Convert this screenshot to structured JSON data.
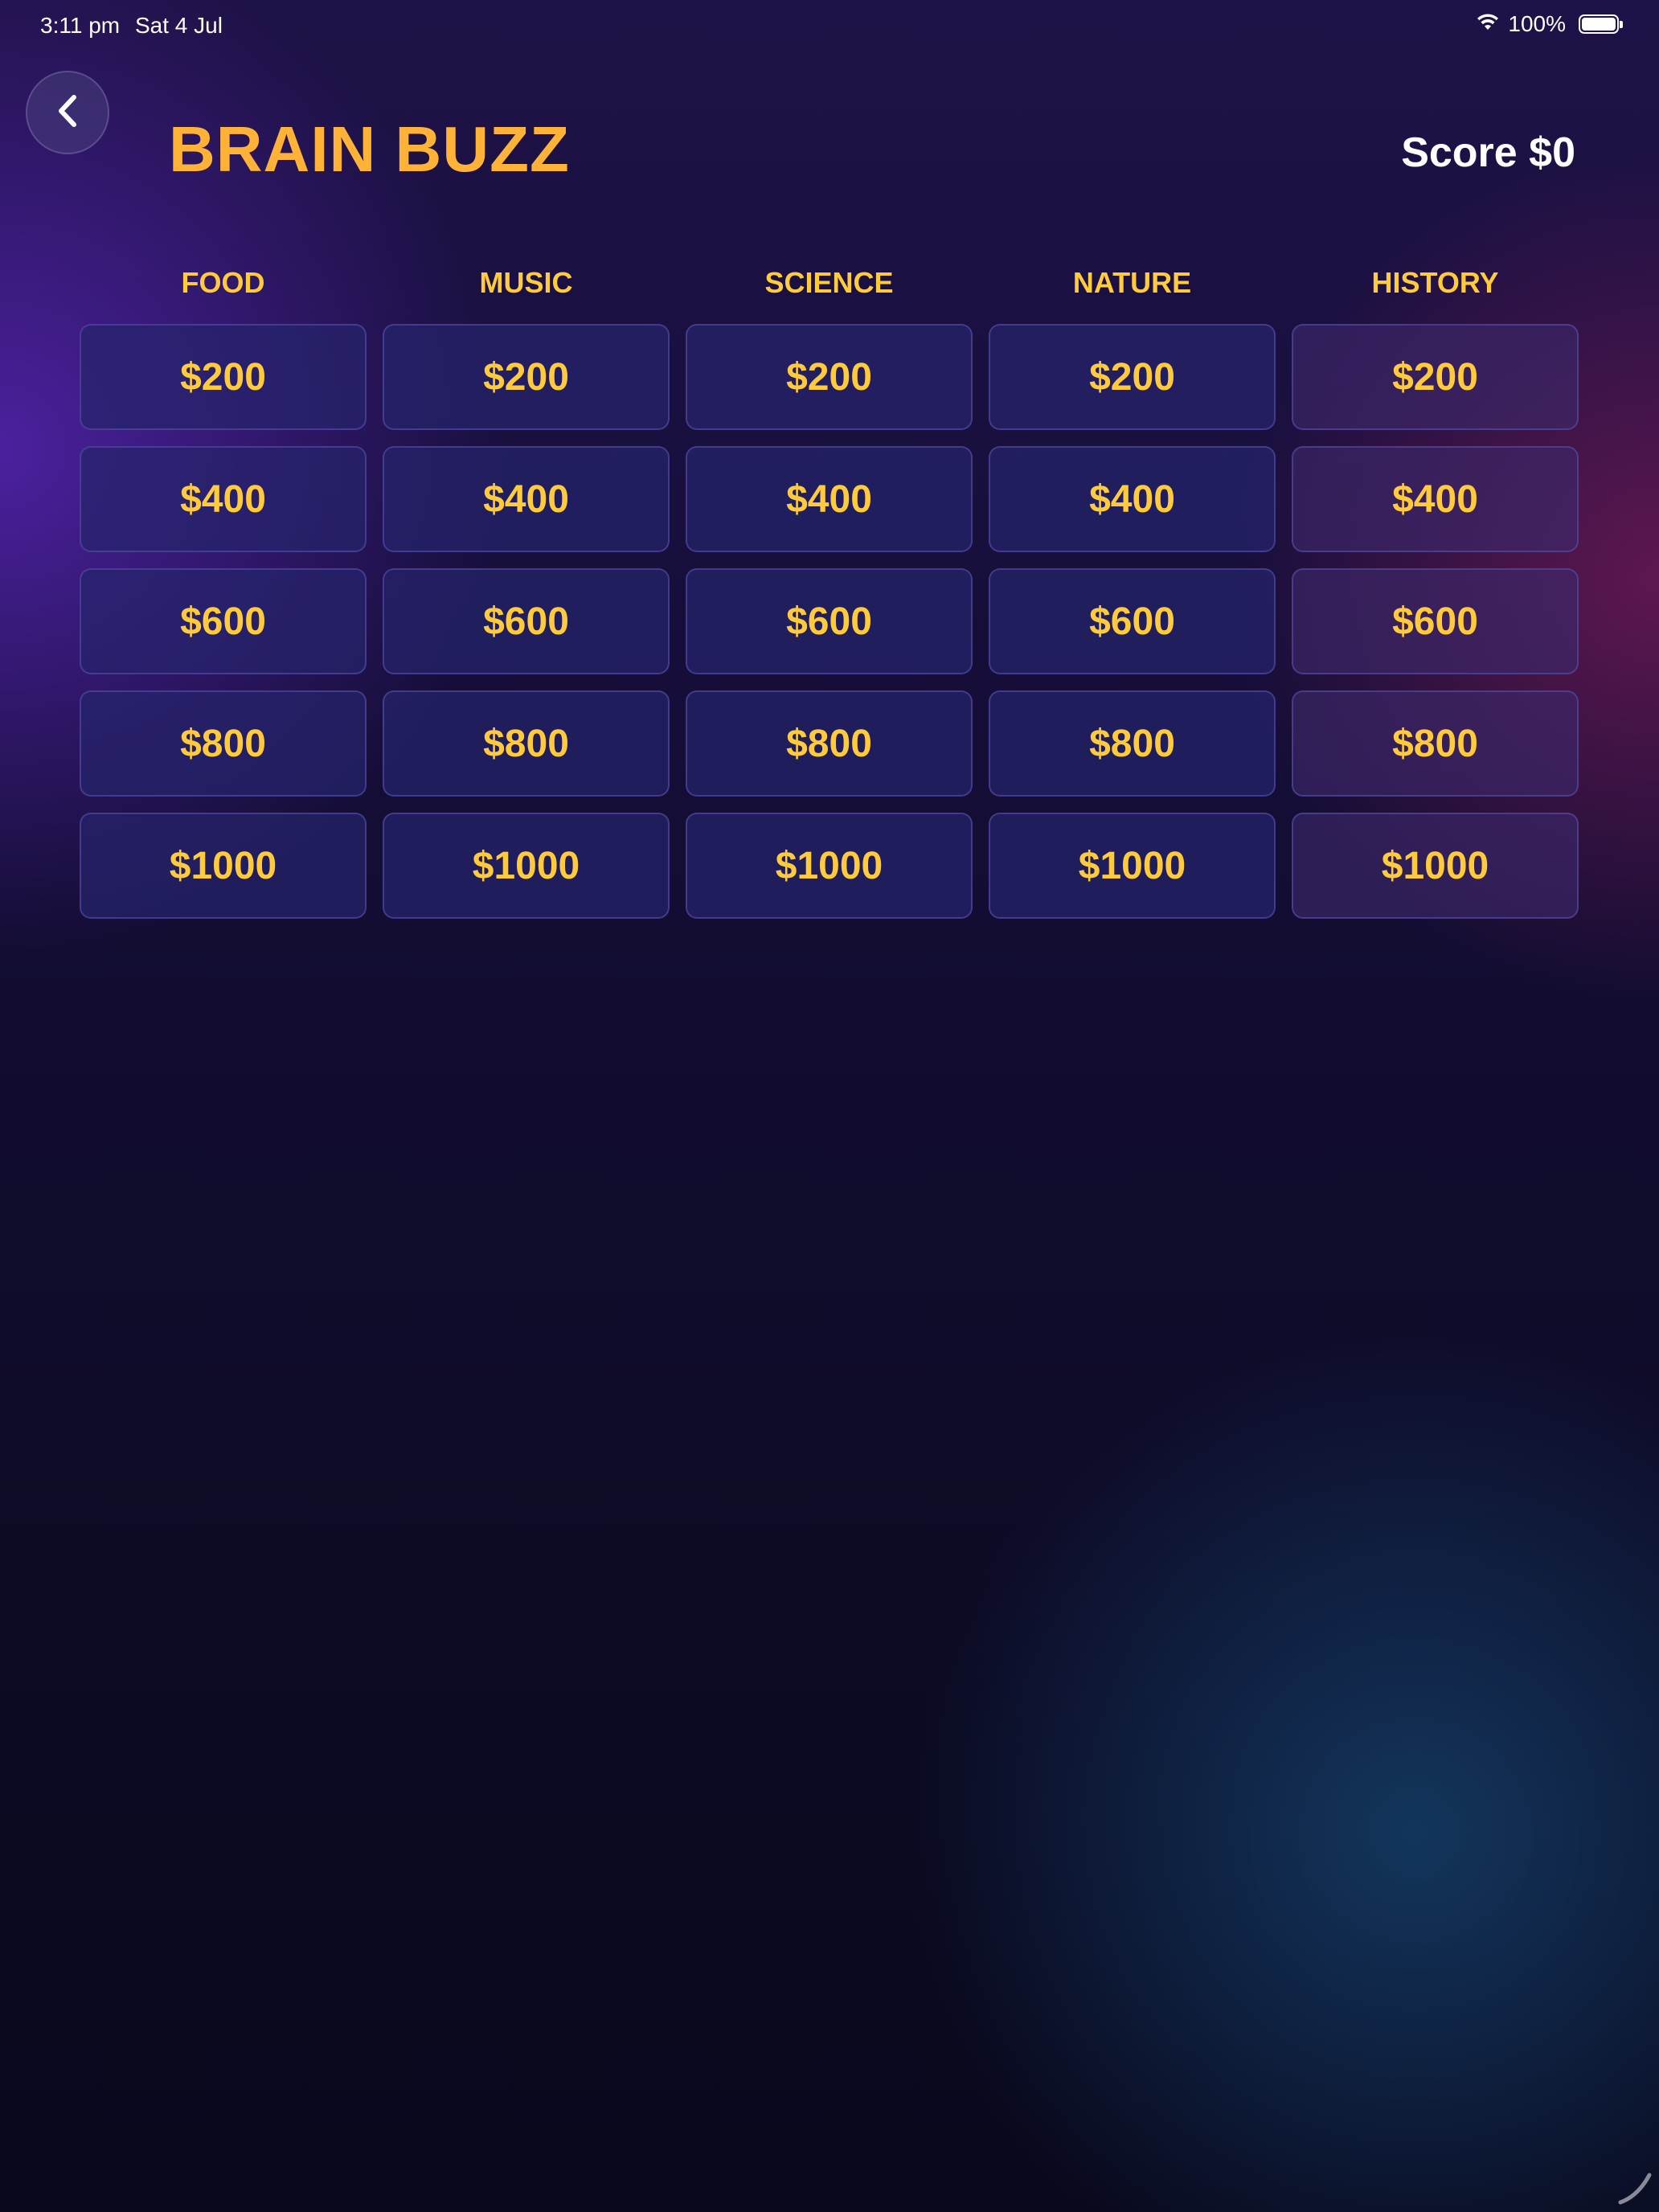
{
  "status_bar": {
    "time": "3:11 pm",
    "date": "Sat 4 Jul",
    "battery": "100%",
    "icons": [
      "wifi-icon",
      "battery-icon"
    ]
  },
  "header": {
    "back_icon": "chevron-left-icon",
    "title": "BRAIN BUZZ",
    "score": "Score $0"
  },
  "board": {
    "categories": [
      "FOOD",
      "MUSIC",
      "SCIENCE",
      "NATURE",
      "HISTORY"
    ],
    "values": [
      "$200",
      "$400",
      "$600",
      "$800",
      "$1000"
    ]
  },
  "colors": {
    "title": "#ffb238",
    "category": "#ffcb3d",
    "tile_text": "#ffcb3d",
    "score": "#ffffff"
  }
}
